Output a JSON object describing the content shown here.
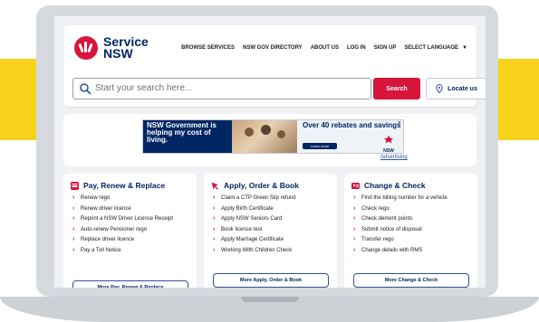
{
  "header": {
    "logo_line1": "Service",
    "logo_line2": "NSW",
    "nav": [
      "BROWSE SERVICES",
      "NSW GOV DIRECTORY",
      "ABOUT US",
      "LOG IN",
      "SIGN UP",
      "SELECT LANGUAGE"
    ],
    "search_placeholder": "Start your search here...",
    "search_button": "Search",
    "locate_button": "Locate us"
  },
  "ad": {
    "left_text": "NSW Government is helping my cost of living.",
    "rebate_text": "Over 40 rebates and savings",
    "learn_more": "Learn more",
    "brand": "NSW",
    "advertising_link": "Advertising"
  },
  "cards": [
    {
      "title": "Pay, Renew & Replace",
      "items": [
        "Renew rego",
        "Renew driver licence",
        "Reprint a NSW Driver Licence Receipt",
        "Auto-renew Pensioner rego",
        "Replace driver licence",
        "Pay a Toll Notice"
      ],
      "more": "More Pay, Renew & Replace"
    },
    {
      "title": "Apply, Order & Book",
      "items": [
        "Claim a CTP Green Slip refund",
        "Apply Birth Certificate",
        "Apply NSW Seniors Card",
        "Book licence test",
        "Apply Marriage Certificate",
        "Working With Children Check"
      ],
      "more": "More Apply, Order & Book"
    },
    {
      "title": "Change & Check",
      "items": [
        "Find the billing number for a vehicle",
        "Check rego",
        "Check demerit points",
        "Submit notice of disposal",
        "Transfer rego",
        "Change details with RMS"
      ],
      "more": "More Change & Check"
    }
  ],
  "colors": {
    "brand_red": "#d7153a",
    "brand_navy": "#002664",
    "band_yellow": "#f7d21b"
  }
}
